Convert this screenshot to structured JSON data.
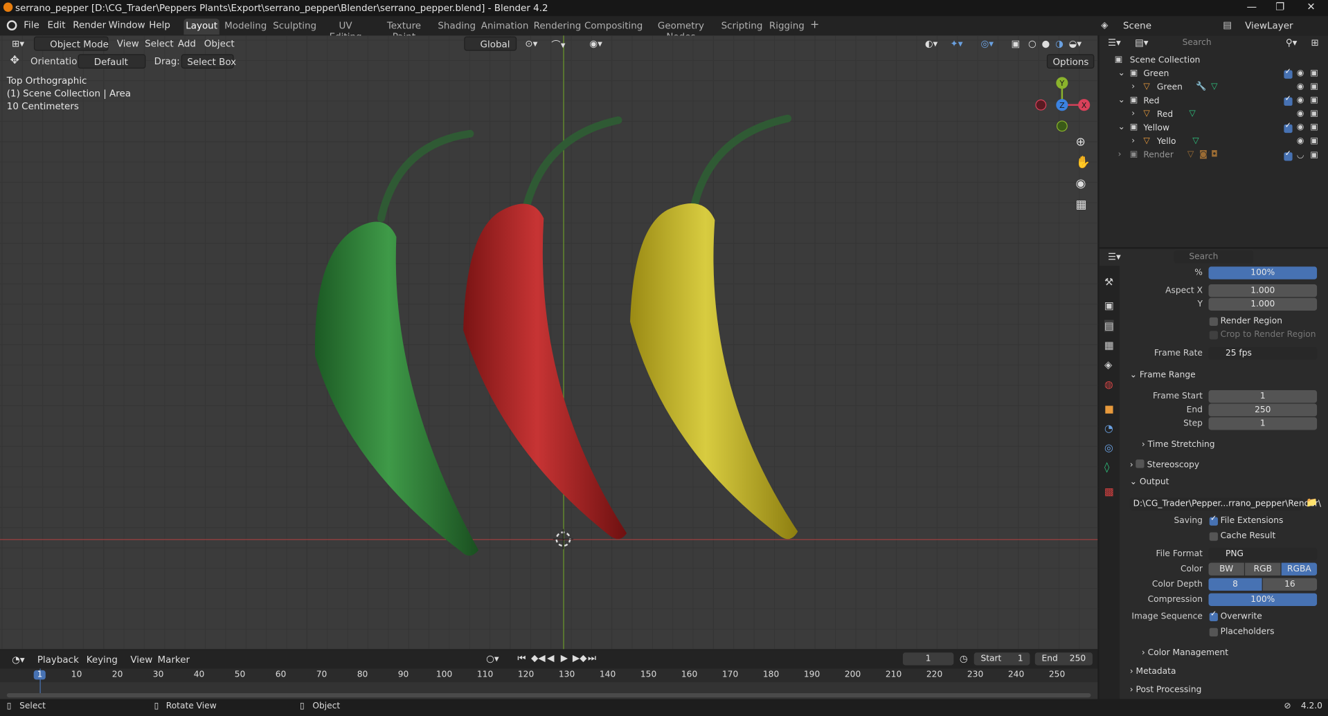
{
  "window": {
    "title": "serrano_pepper [D:\\CG_Trader\\Peppers Plants\\Export\\serrano_pepper\\Blender\\serrano_pepper.blend] - Blender 4.2"
  },
  "menu": [
    "File",
    "Edit",
    "Render",
    "Window",
    "Help"
  ],
  "workspaces": [
    "Layout",
    "Modeling",
    "Sculpting",
    "UV Editing",
    "Texture Paint",
    "Shading",
    "Animation",
    "Rendering",
    "Compositing",
    "Geometry Nodes",
    "Scripting",
    "Rigging"
  ],
  "scene": {
    "name": "Scene",
    "view_layer": "ViewLayer"
  },
  "viewport_header": {
    "mode": "Object Mode",
    "menus": [
      "View",
      "Select",
      "Add",
      "Object"
    ],
    "transform": "Global",
    "orientation_label": "Orientation:",
    "orientation": "Default",
    "drag_label": "Drag:",
    "drag": "Select Box",
    "options": "Options"
  },
  "viewport_overlay": {
    "view": "Top Orthographic",
    "collection": "(1) Scene Collection | Area",
    "scale": "10 Centimeters"
  },
  "gizmo": {
    "y": "Y",
    "z": "Z",
    "x": "X"
  },
  "peppers": [
    {
      "name": "Green",
      "color": "#2e7a2e"
    },
    {
      "name": "Red",
      "color": "#b42424"
    },
    {
      "name": "Yellow",
      "color": "#c7b61c"
    }
  ],
  "outliner": {
    "search": "Search",
    "root": "Scene Collection",
    "items": [
      {
        "label": "Green",
        "type": "collection"
      },
      {
        "label": "Green",
        "type": "object"
      },
      {
        "label": "Red",
        "type": "collection"
      },
      {
        "label": "Red",
        "type": "object"
      },
      {
        "label": "Yellow",
        "type": "collection"
      },
      {
        "label": "Yello",
        "type": "object"
      },
      {
        "label": "Render",
        "type": "collection"
      }
    ]
  },
  "properties": {
    "search": "Search",
    "resolution_pct_label": "%",
    "resolution_pct": "100%",
    "aspect_x_label": "Aspect X",
    "aspect_x": "1.000",
    "aspect_y_label": "Y",
    "aspect_y": "1.000",
    "render_region": "Render Region",
    "crop_region": "Crop to Render Region",
    "frame_rate_label": "Frame Rate",
    "frame_rate": "25 fps",
    "frame_range": "Frame Range",
    "frame_start_label": "Frame Start",
    "frame_start": "1",
    "end_label": "End",
    "end": "250",
    "step_label": "Step",
    "step": "1",
    "time_stretching": "Time Stretching",
    "stereoscopy": "Stereoscopy",
    "output": "Output",
    "output_path": "D:\\CG_Trader\\Pepper...rrano_pepper\\Render\\",
    "saving_label": "Saving",
    "file_extensions": "File Extensions",
    "cache_result": "Cache Result",
    "file_format_label": "File Format",
    "file_format": "PNG",
    "color_label": "Color",
    "color_opts": [
      "BW",
      "RGB",
      "RGBA"
    ],
    "color_depth_label": "Color Depth",
    "color_depth_opts": [
      "8",
      "16"
    ],
    "compression_label": "Compression",
    "compression": "100%",
    "image_sequence_label": "Image Sequence",
    "overwrite": "Overwrite",
    "placeholders": "Placeholders",
    "color_management": "Color Management",
    "metadata": "Metadata",
    "post_processing": "Post Processing"
  },
  "timeline": {
    "menus": [
      "Playback",
      "Keying",
      "View",
      "Marker"
    ],
    "current_frame": "1",
    "start_label": "Start",
    "start": "1",
    "end_label": "End",
    "end": "250",
    "ticks": [
      "1",
      "10",
      "20",
      "30",
      "40",
      "50",
      "60",
      "70",
      "80",
      "90",
      "100",
      "110",
      "120",
      "130",
      "140",
      "150",
      "160",
      "170",
      "180",
      "190",
      "200",
      "210",
      "220",
      "230",
      "240",
      "250"
    ]
  },
  "status": {
    "select": "Select",
    "rotate": "Rotate View",
    "object": "Object",
    "version": "4.2.0"
  }
}
